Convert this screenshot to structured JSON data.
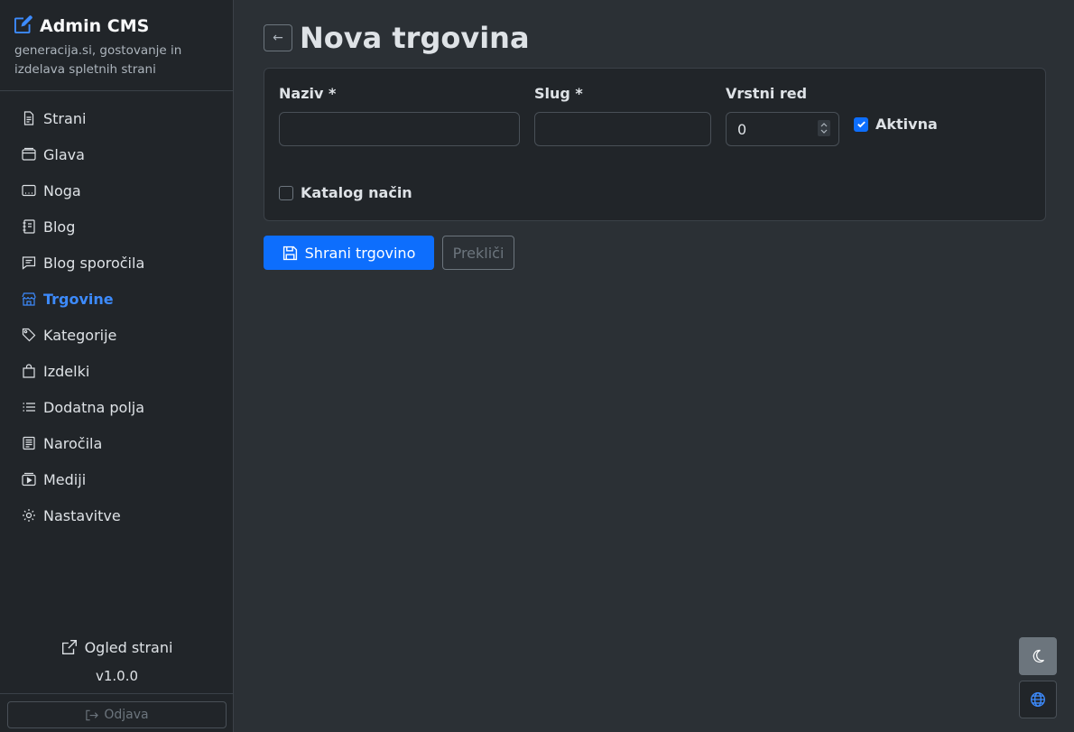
{
  "app": {
    "title": "Admin CMS",
    "subtitle": "generacija.si, gostovanje in izdelava spletnih strani"
  },
  "sidebar": {
    "items": [
      {
        "label": "Strani",
        "icon": "file-text-icon"
      },
      {
        "label": "Glava",
        "icon": "window-icon"
      },
      {
        "label": "Noga",
        "icon": "footer-icon"
      },
      {
        "label": "Blog",
        "icon": "journal-icon"
      },
      {
        "label": "Blog sporočila",
        "icon": "chat-icon"
      },
      {
        "label": "Trgovine",
        "icon": "shop-icon",
        "active": true
      },
      {
        "label": "Kategorije",
        "icon": "tags-icon"
      },
      {
        "label": "Izdelki",
        "icon": "bag-icon"
      },
      {
        "label": "Dodatna polja",
        "icon": "list-icon"
      },
      {
        "label": "Naročila",
        "icon": "receipt-icon"
      },
      {
        "label": "Mediji",
        "icon": "media-icon"
      },
      {
        "label": "Nastavitve",
        "icon": "gear-icon"
      }
    ],
    "view_site": "Ogled strani",
    "version": "v1.0.0",
    "logout": "Odjava"
  },
  "page": {
    "back": "←",
    "title": "Nova trgovina"
  },
  "form": {
    "name_label": "Naziv *",
    "name_value": "",
    "slug_label": "Slug *",
    "slug_value": "",
    "order_label": "Vrstni red",
    "order_value": "0",
    "active_label": "Aktivna",
    "active_checked": true,
    "catalog_label": "Katalog način",
    "catalog_checked": false
  },
  "actions": {
    "save": "Shrani trgovino",
    "cancel": "Prekliči"
  },
  "colors": {
    "accent": "#0d6efd",
    "active_link": "#3d8bfd",
    "background": "#2b3035",
    "sidebar": "#212529"
  }
}
